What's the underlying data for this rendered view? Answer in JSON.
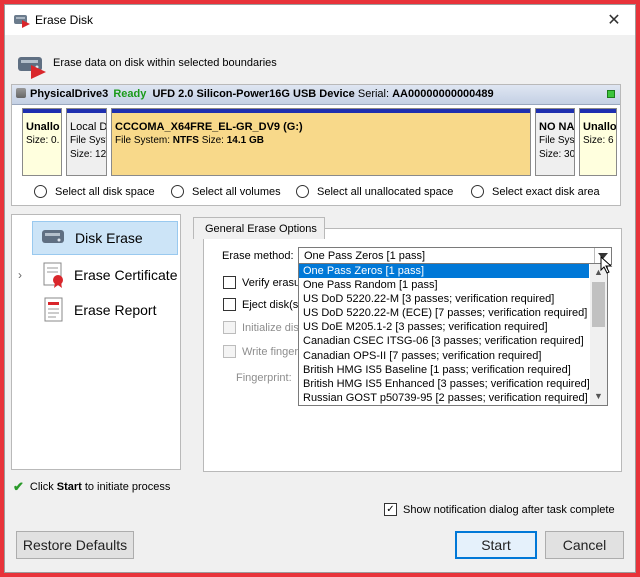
{
  "window": {
    "title": "Erase Disk",
    "close_glyph": "✕"
  },
  "header": {
    "description": "Erase data on disk within selected boundaries"
  },
  "disk": {
    "drive": "PhysicalDrive3",
    "status": "Ready",
    "model": "UFD 2.0 Silicon-Power16G USB Device",
    "serial_label": "Serial:",
    "serial": "AA00000000000489",
    "partitions": [
      {
        "name": "Unallo",
        "line2": "Size: 0."
      },
      {
        "name": "Local D",
        "line2": "File Syst",
        "line3": "Size: 12"
      },
      {
        "name": "CCCOMA_X64FRE_EL-GR_DV9 (G:)",
        "fs_label": "File System:",
        "fs": "NTFS",
        "size_label": "Size:",
        "size": "14.1 GB"
      },
      {
        "name": "NO NA",
        "line2": "File Syst",
        "line3": "Size: 30"
      },
      {
        "name": "Unallo",
        "line2": "Size: 6"
      }
    ]
  },
  "select_options": [
    "Select all disk space",
    "Select all volumes",
    "Select all unallocated space",
    "Select exact disk area"
  ],
  "nav": [
    {
      "label": "Disk Erase",
      "icon": "disk-erase-icon"
    },
    {
      "label": "Erase Certificate",
      "icon": "certificate-icon"
    },
    {
      "label": "Erase Report",
      "icon": "report-icon"
    }
  ],
  "nav_chevron": "›",
  "options": {
    "group_title": "General Erase Options",
    "erase_method_label": "Erase method:",
    "erase_method_value": "One Pass Zeros [1 pass]",
    "verify_label": "Verify erasu",
    "eject_label": "Eject disk(s)",
    "init_label": "Initialize disk",
    "write_fp_label": "Write finger",
    "fingerprint_label": "Fingerprint:"
  },
  "methods": [
    "One Pass Zeros [1 pass]",
    "One Pass Random [1 pass]",
    "US DoD 5220.22-M [3 passes; verification required]",
    "US DoD 5220.22-M (ECE) [7 passes; verification required]",
    "US DoE M205.1-2 [3 passes; verification required]",
    "Canadian CSEC ITSG-06 [3 passes; verification required]",
    "Canadian OPS-II [7 passes; verification required]",
    "British HMG IS5 Baseline [1 pass; verification required]",
    "British HMG IS5 Enhanced [3 passes; verification required]",
    "Russian GOST p50739-95 [2 passes; verification required]"
  ],
  "footer": {
    "hint_pre": "Click",
    "hint_bold": "Start",
    "hint_post": "to initiate process",
    "notify_label": "Show notification dialog after task complete",
    "notify_checked": "✓",
    "restore_label": "Restore Defaults",
    "start_label": "Start",
    "cancel_label": "Cancel"
  },
  "colors": {
    "ready": "#1a9a1a",
    "selection": "#0078d7",
    "partition_bar": "#1e2fb0",
    "volume_fill": "#f8d98a"
  }
}
